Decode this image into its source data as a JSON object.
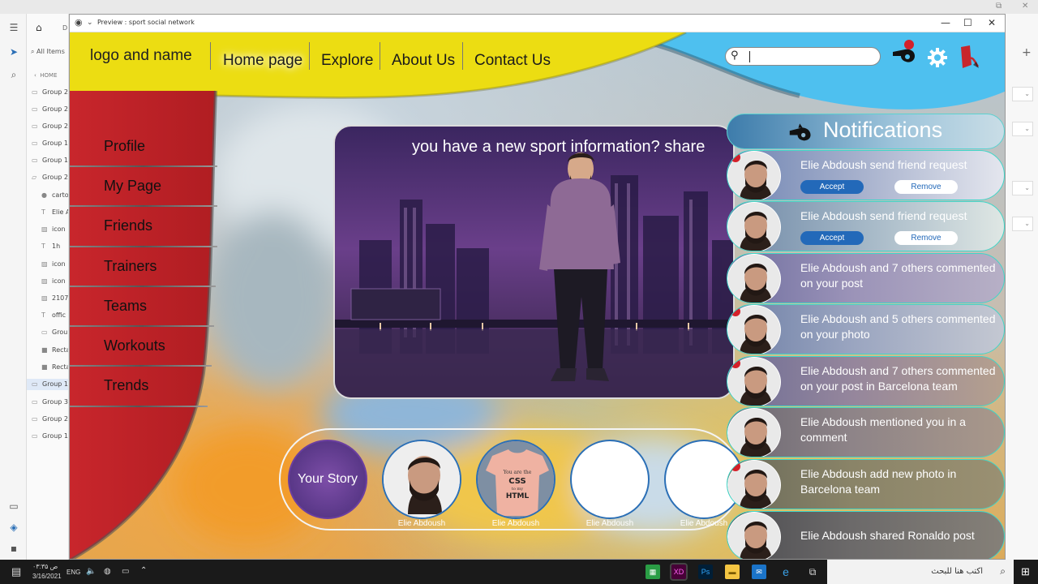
{
  "xd": {
    "menu_icon": "hamburger-icon",
    "home_icon": "home-icon",
    "doc_tab": "D",
    "search_placeholder": "All Items",
    "breadcrumb": "HOME",
    "layers": [
      {
        "label": "Group 2",
        "icon": "folder-icon"
      },
      {
        "label": "Group 2",
        "icon": "folder-icon"
      },
      {
        "label": "Group 2",
        "icon": "folder-icon"
      },
      {
        "label": "Group 1",
        "icon": "folder-icon"
      },
      {
        "label": "Group 1",
        "icon": "folder-icon"
      },
      {
        "label": "Group 2",
        "icon": "folder-open-icon"
      },
      {
        "label": "carto",
        "icon": "ellipse-icon"
      },
      {
        "label": "Elie A",
        "icon": "text-icon"
      },
      {
        "label": "icon",
        "icon": "image-icon"
      },
      {
        "label": "1h",
        "icon": "text-icon"
      },
      {
        "label": "icon",
        "icon": "image-icon"
      },
      {
        "label": "icon",
        "icon": "image-icon"
      },
      {
        "label": "2107",
        "icon": "image-icon"
      },
      {
        "label": "offic",
        "icon": "text-icon"
      },
      {
        "label": "Grou",
        "icon": "folder-icon"
      },
      {
        "label": "Recta",
        "icon": "rect-icon"
      },
      {
        "label": "Recta",
        "icon": "rect-icon"
      },
      {
        "label": "Group 1",
        "icon": "folder-icon"
      },
      {
        "label": "Group 3",
        "icon": "folder-icon"
      },
      {
        "label": "Group 2",
        "icon": "folder-icon"
      },
      {
        "label": "Group 1",
        "icon": "folder-icon"
      }
    ]
  },
  "preview": {
    "title": "Preview : sport social network",
    "min_label": "—",
    "max_label": "☐",
    "close_label": "✕"
  },
  "site": {
    "logo": "logo and name",
    "nav": [
      "Home page",
      "Explore",
      "About Us",
      "Contact Us"
    ],
    "search_icon": "search-icon",
    "header_icons": [
      "whistle-icon",
      "gear-icon",
      "exit-icon"
    ],
    "sidebar": [
      "Profile",
      "My Page",
      "Friends",
      "Trainers",
      "Teams",
      "Workouts",
      "Trends"
    ],
    "banner_text": "you have a new sport information? share",
    "your_story": "Your Story",
    "stories": [
      "Elie Abdoush",
      "Elie Abdoush",
      "Elie Abdoush",
      "Elie Abdoush"
    ]
  },
  "notifications": {
    "title": "Notifications",
    "icon": "whistle-icon",
    "items": [
      {
        "text": "Elie Abdoush send friend request",
        "unread": true,
        "accept": "Accept",
        "remove": "Remove"
      },
      {
        "text": "Elie Abdoush send friend request",
        "unread": false,
        "accept": "Accept",
        "remove": "Remove"
      },
      {
        "text": "Elie Abdoush and 7 others commented on your post",
        "unread": false
      },
      {
        "text": "Elie Abdoush and 5 others commented on your photo",
        "unread": true
      },
      {
        "text": "Elie Abdoush and 7 others commented on your post in Barcelona team",
        "unread": true
      },
      {
        "text": "Elie Abdoush mentioned you in a comment",
        "unread": false
      },
      {
        "text": "Elie Abdoush add new photo in Barcelona team",
        "unread": true
      },
      {
        "text": "Elie Abdoush shared Ronaldo post",
        "unread": false
      }
    ]
  },
  "taskbar": {
    "time": "۰۳:۳۵ ص",
    "date": "3/16/2021",
    "lang": "ENG",
    "search_text": "اكتب هنا للبحث",
    "apps": [
      "XD",
      "Ps"
    ]
  }
}
